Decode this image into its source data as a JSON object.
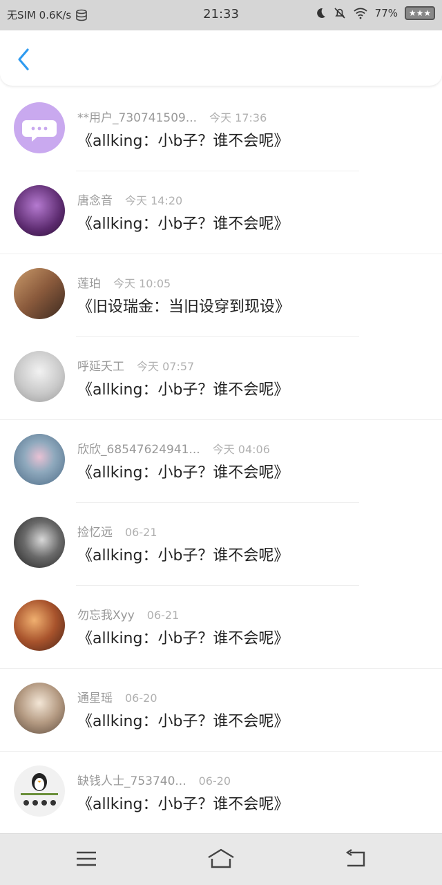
{
  "status_bar": {
    "carrier": "无SIM 0.6K/s",
    "time": "21:33",
    "battery": "77%"
  },
  "header": {
    "back_icon": "chevron-left-icon",
    "accent_color": "#2f9bf0"
  },
  "messages": [
    {
      "user": "**用户_730741509...",
      "time": "今天 17:36",
      "text": "《allking：小b子？谁不会呢》",
      "avatar_color": "#c9a9ef"
    },
    {
      "user": "唐念音",
      "time": "今天 14:20",
      "text": "《allking：小b子？谁不会呢》",
      "avatar_color": "#5b2a6e"
    },
    {
      "user": "莲珀",
      "time": "今天 10:05",
      "text": "《旧设瑞金：当旧设穿到现设》",
      "avatar_color": "#8a5a3c"
    },
    {
      "user": "呼延夭工",
      "time": "今天 07:57",
      "text": "《allking：小b子？谁不会呢》",
      "avatar_color": "#c9c9c9"
    },
    {
      "user": "欣欣_68547624941...",
      "time": "今天 04:06",
      "text": "《allking：小b子？谁不会呢》",
      "avatar_color": "#6d8aa6"
    },
    {
      "user": "捡忆远",
      "time": "06-21",
      "text": "《allking：小b子？谁不会呢》",
      "avatar_color": "#3a3a3a"
    },
    {
      "user": "勿忘我Xyy",
      "time": "06-21",
      "text": "《allking：小b子？谁不会呢》",
      "avatar_color": "#a8532c"
    },
    {
      "user": "通星瑶",
      "time": "06-20",
      "text": "《allking：小b子？谁不会呢》",
      "avatar_color": "#8e7a68"
    },
    {
      "user": "缺钱人士_753740...",
      "time": "06-20",
      "text": "《allking：小b子？谁不会呢》",
      "avatar_color": "#f1f1f1"
    }
  ],
  "nav_bar": {
    "menu_icon": "menu-icon",
    "home_icon": "home-icon",
    "back_icon": "back-arrow-icon"
  }
}
